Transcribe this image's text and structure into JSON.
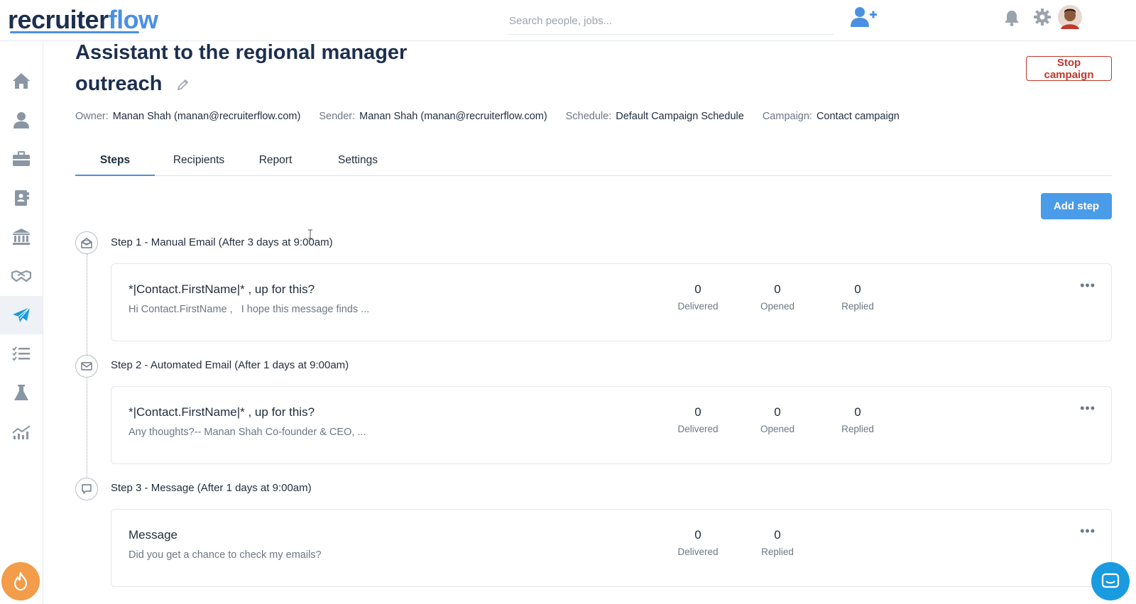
{
  "app": {
    "logo_part1": "recruiter",
    "logo_part2": "flow"
  },
  "header": {
    "search_placeholder": "Search people, jobs...",
    "icons": [
      "add-user-icon",
      "bell-icon",
      "gear-icon",
      "avatar"
    ]
  },
  "sidebar": {
    "items": [
      {
        "icon": "home-icon",
        "active": false
      },
      {
        "icon": "person-icon",
        "active": false
      },
      {
        "icon": "briefcase-icon",
        "active": false
      },
      {
        "icon": "contact-book-icon",
        "active": false
      },
      {
        "icon": "bank-icon",
        "active": false
      },
      {
        "icon": "handshake-icon",
        "active": false
      },
      {
        "icon": "paper-plane-icon",
        "active": true
      },
      {
        "icon": "checklist-icon",
        "active": false
      },
      {
        "icon": "flask-icon",
        "active": false
      },
      {
        "icon": "analytics-icon",
        "active": false
      }
    ]
  },
  "campaign": {
    "title_line1": "Assistant to the regional manager",
    "title_line2": "outreach",
    "stop_label": "Stop campaign",
    "meta": {
      "owner_label": "Owner:",
      "owner_value": "Manan Shah (manan@recruiterflow.com)",
      "sender_label": "Sender:",
      "sender_value": "Manan Shah (manan@recruiterflow.com)",
      "schedule_label": "Schedule:",
      "schedule_value": "Default Campaign Schedule",
      "campaign_label": "Campaign:",
      "campaign_value": "Contact campaign"
    }
  },
  "tabs": [
    {
      "label": "Steps",
      "active": true
    },
    {
      "label": "Recipients",
      "active": false
    },
    {
      "label": "Report",
      "active": false
    },
    {
      "label": "Settings",
      "active": false
    }
  ],
  "add_step_label": "Add step",
  "steps": [
    {
      "title": "Step 1 - Manual Email (After 3 days at 9:00am)",
      "icon": "email-open-icon",
      "subject": "*|Contact.FirstName|* , up for this?",
      "preview": "Hi Contact.FirstName ,   I hope this message finds ...",
      "stats": [
        {
          "value": "0",
          "label": "Delivered"
        },
        {
          "value": "0",
          "label": "Opened"
        },
        {
          "value": "0",
          "label": "Replied"
        }
      ]
    },
    {
      "title": "Step 2 - Automated Email (After 1 days at 9:00am)",
      "icon": "envelope-icon",
      "subject": "*|Contact.FirstName|* , up for this?",
      "preview": "Any thoughts?-- Manan Shah Co-founder & CEO, ...",
      "stats": [
        {
          "value": "0",
          "label": "Delivered"
        },
        {
          "value": "0",
          "label": "Opened"
        },
        {
          "value": "0",
          "label": "Replied"
        }
      ]
    },
    {
      "title": "Step 3 - Message (After 1 days at 9:00am)",
      "icon": "chat-bubble-icon",
      "subject": "Message",
      "preview": "Did you get a chance to check my emails?",
      "stats": [
        {
          "value": "0",
          "label": "Delivered"
        },
        {
          "value": "0",
          "label": "Replied"
        }
      ]
    }
  ],
  "colors": {
    "brand_dark": "#1d2f4e",
    "brand_blue": "#4a90e2",
    "stop_red": "#c0392b",
    "add_button": "#4a9be8",
    "fab_orange": "#f39c4a",
    "fab_blue": "#1a9be0"
  }
}
